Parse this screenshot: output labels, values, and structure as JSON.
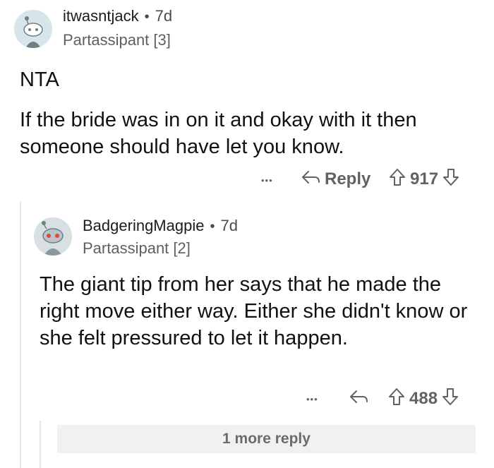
{
  "comment1": {
    "username": "itwasntjack",
    "separator": "•",
    "age": "7d",
    "flair": "Partassipant [3]",
    "verdict": "NTA",
    "body": "If the bride was in on it and okay with it then someone should have let you know.",
    "more_label": "•••",
    "reply_label": "Reply",
    "score": "917",
    "icons": [
      "overflow-dots-icon",
      "reply-arrow-icon",
      "upvote-arrow-icon",
      "downvote-arrow-icon"
    ]
  },
  "comment2": {
    "username": "BadgeringMagpie",
    "separator": "•",
    "age": "7d",
    "flair": "Partassipant [2]",
    "body": "The giant tip from her says that he made the right move either way. Either she didn't know or she felt pressured to let it happen.",
    "more_label": "•••",
    "score": "488",
    "icons": [
      "overflow-dots-icon",
      "reply-arrow-icon",
      "upvote-arrow-icon",
      "downvote-arrow-icon"
    ]
  },
  "more_replies": {
    "label": "1 more reply"
  },
  "colors": {
    "meta_text": "#5f6368",
    "bar_bg": "#f0f1f3",
    "thread_line": "#e6e6e6"
  }
}
